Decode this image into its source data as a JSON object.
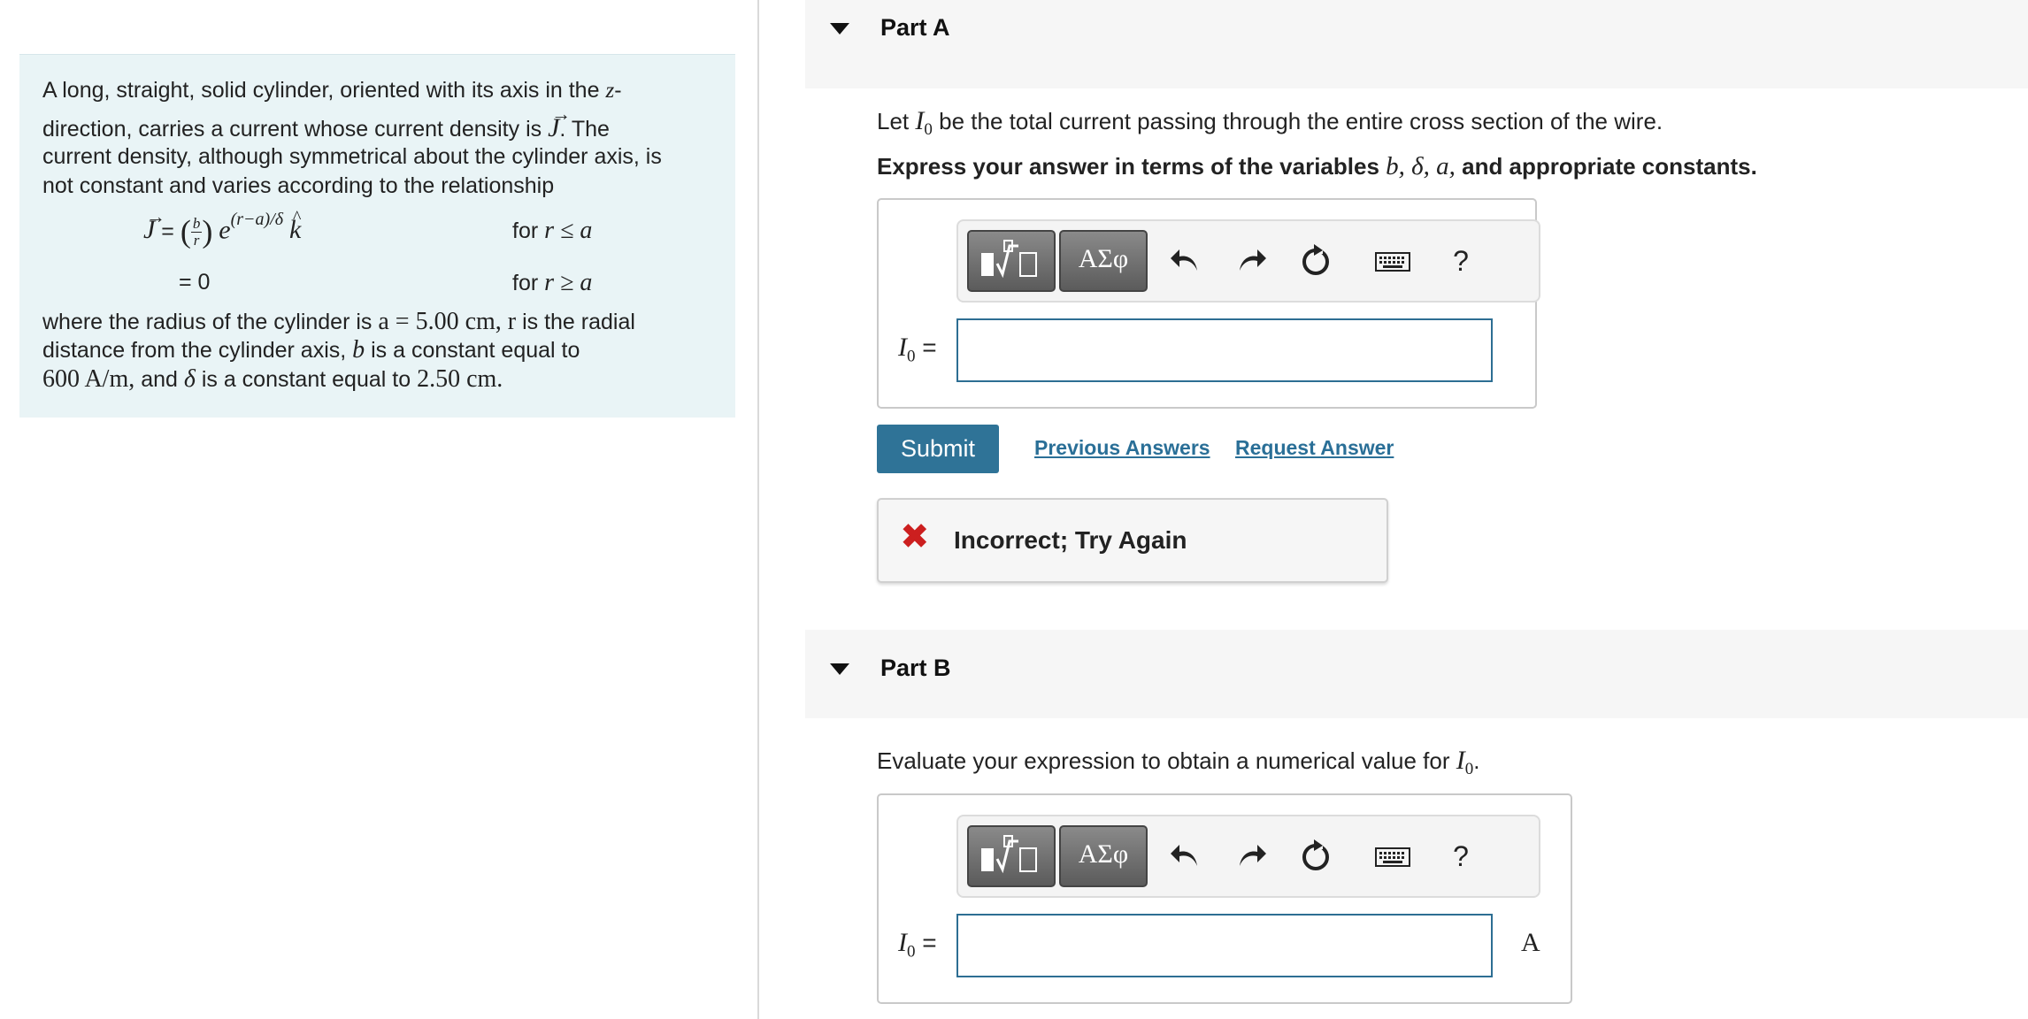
{
  "problem": {
    "line1": "A long, straight, solid cylinder, oriented with its axis in the",
    "line1_var": "z",
    "line1_end": "-",
    "line2_start": "direction, carries a current whose current density is",
    "line2_var": "J",
    "line2_end": ". The",
    "line3": "current density, although symmetrical about the cylinder axis, is",
    "line4": "not constant and varies according to the relationship",
    "eq1_lhs": "J",
    "eq1_eq": " =",
    "eq1_frac_num": "b",
    "eq1_frac_den": "r",
    "eq1_exp_base": "e",
    "eq1_exponent": "(r−a)/δ",
    "eq1_unit_vec": "k",
    "eq1_cond_prefix": "for ",
    "eq1_cond": "r ≤ a",
    "eq2_lhs": "= 0",
    "eq2_cond_prefix": "for ",
    "eq2_cond": "r ≥ a",
    "line5_a": "where the radius of the cylinder is",
    "line5_math": "a = 5.00 cm, r",
    "line5_b": "is the radial",
    "line6_a": "distance from the cylinder axis,",
    "line6_var": "b",
    "line6_b": "is a constant equal to",
    "line7_math1": "600 A/m,",
    "line7_a": "and",
    "line7_var": "δ",
    "line7_b": "is a constant equal to",
    "line7_math2": "2.50 cm."
  },
  "part_a": {
    "title": "Part A",
    "prompt_a": "Let",
    "prompt_var": "I",
    "prompt_sub": "0",
    "prompt_b": "be the total current passing through the entire cross section of the wire.",
    "instruction_a": "Express your answer in terms of the variables",
    "instruction_vars": "b, δ, a,",
    "instruction_b": "and appropriate constants.",
    "answer_label_var": "I",
    "answer_label_sub": "0",
    "answer_label_eq": " =",
    "submit_label": "Submit",
    "previous_answers": "Previous Answers",
    "request_answer": "Request Answer",
    "feedback_icon": "✖",
    "feedback_text": "Incorrect; Try Again"
  },
  "part_b": {
    "title": "Part B",
    "prompt_a": "Evaluate your expression to obtain a numerical value for",
    "prompt_var": "I",
    "prompt_sub": "0",
    "prompt_end": ".",
    "answer_label_var": "I",
    "answer_label_sub": "0",
    "answer_label_eq": " =",
    "unit": "A"
  },
  "toolbar": {
    "greek_label": "ΑΣφ",
    "help_label": "?",
    "icons": [
      "templates-icon",
      "greek-icon",
      "undo-icon",
      "redo-icon",
      "reset-icon",
      "keyboard-icon",
      "help-icon"
    ]
  },
  "colors": {
    "accent": "#2f7397",
    "link": "#2a6f97",
    "error": "#cc1f1f",
    "panel_bg": "#e9f4f6"
  }
}
